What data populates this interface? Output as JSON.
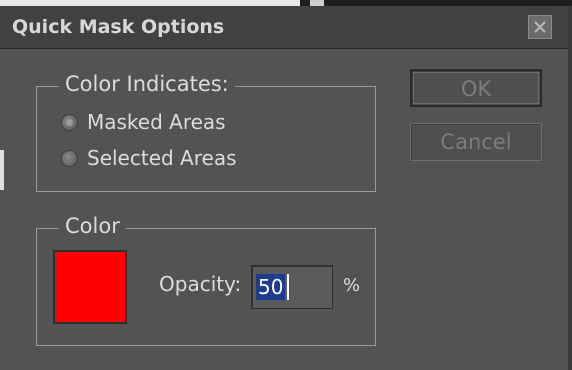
{
  "dialog": {
    "title": "Quick Mask Options"
  },
  "color_indicates": {
    "legend": "Color Indicates:",
    "options": [
      {
        "label": "Masked Areas",
        "selected": true
      },
      {
        "label": "Selected Areas",
        "selected": false
      }
    ]
  },
  "color_group": {
    "legend": "Color",
    "swatch_color": "#ff0000",
    "opacity_label": "Opacity:",
    "opacity_value": "50",
    "opacity_unit": "%"
  },
  "buttons": {
    "ok": "OK",
    "cancel": "Cancel"
  }
}
